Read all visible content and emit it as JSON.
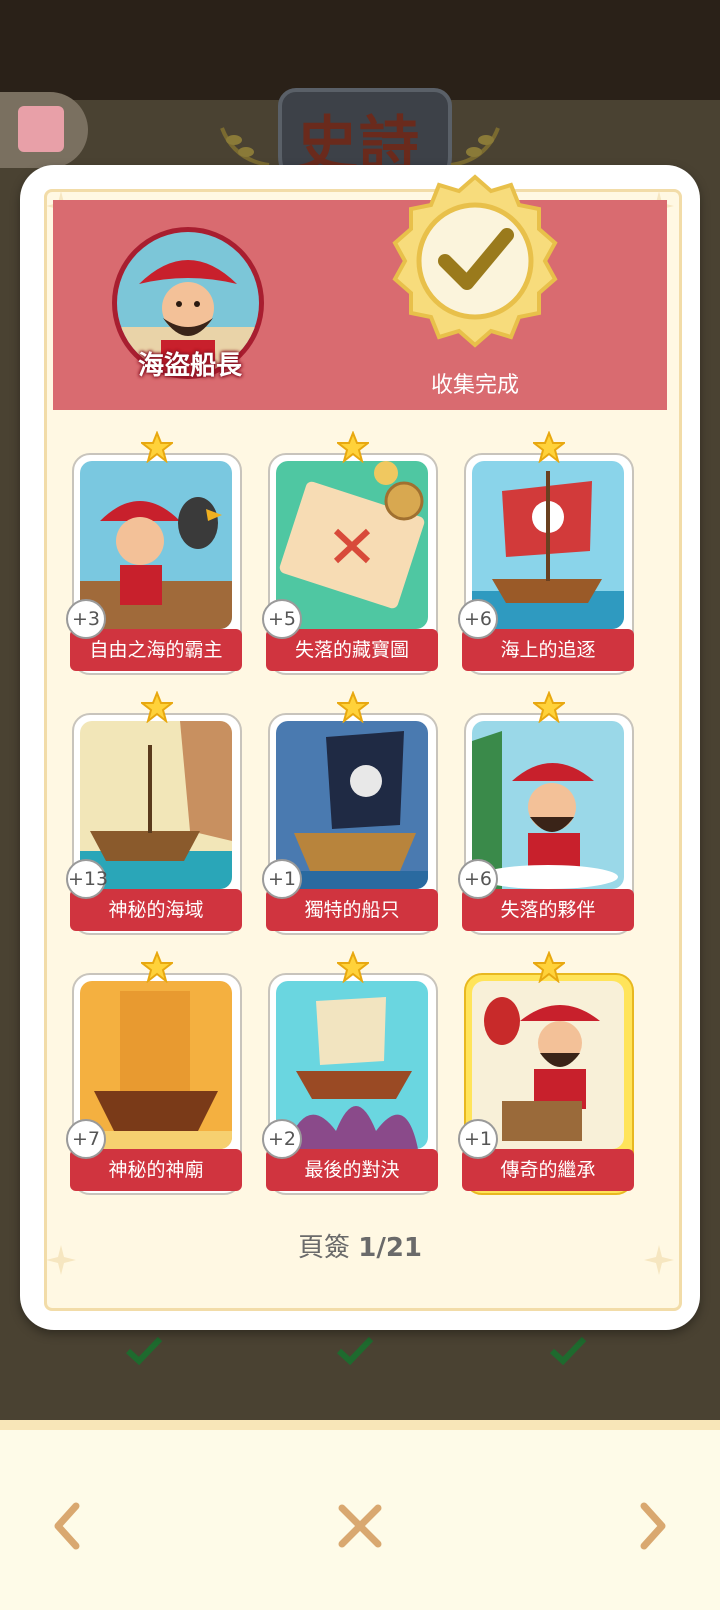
{
  "background": {
    "title": "史詩"
  },
  "header": {
    "character_name": "海盜船長",
    "status_label": "收集完成"
  },
  "cards": [
    {
      "title": "自由之海的霸主",
      "count": "+3",
      "gold": false
    },
    {
      "title": "失落的藏寶圖",
      "count": "+5",
      "gold": false
    },
    {
      "title": "海上的追逐",
      "count": "+6",
      "gold": false
    },
    {
      "title": "神秘的海域",
      "count": "+13",
      "gold": false
    },
    {
      "title": "獨特的船只",
      "count": "+1",
      "gold": false
    },
    {
      "title": "失落的夥伴",
      "count": "+6",
      "gold": false
    },
    {
      "title": "神秘的神廟",
      "count": "+7",
      "gold": false
    },
    {
      "title": "最後的對決",
      "count": "+2",
      "gold": false
    },
    {
      "title": "傳奇的繼承",
      "count": "+1",
      "gold": true
    }
  ],
  "pagination": {
    "label": "頁簽",
    "value": "1/21"
  },
  "nav": {
    "prev_icon": "chevron-left-icon",
    "close_icon": "close-icon",
    "next_icon": "chevron-right-icon"
  },
  "colors": {
    "header_band": "#d96b70",
    "card_banner": "#d0343f",
    "nav_icon": "#d9a870",
    "seal_gold": "#f0c84a"
  }
}
